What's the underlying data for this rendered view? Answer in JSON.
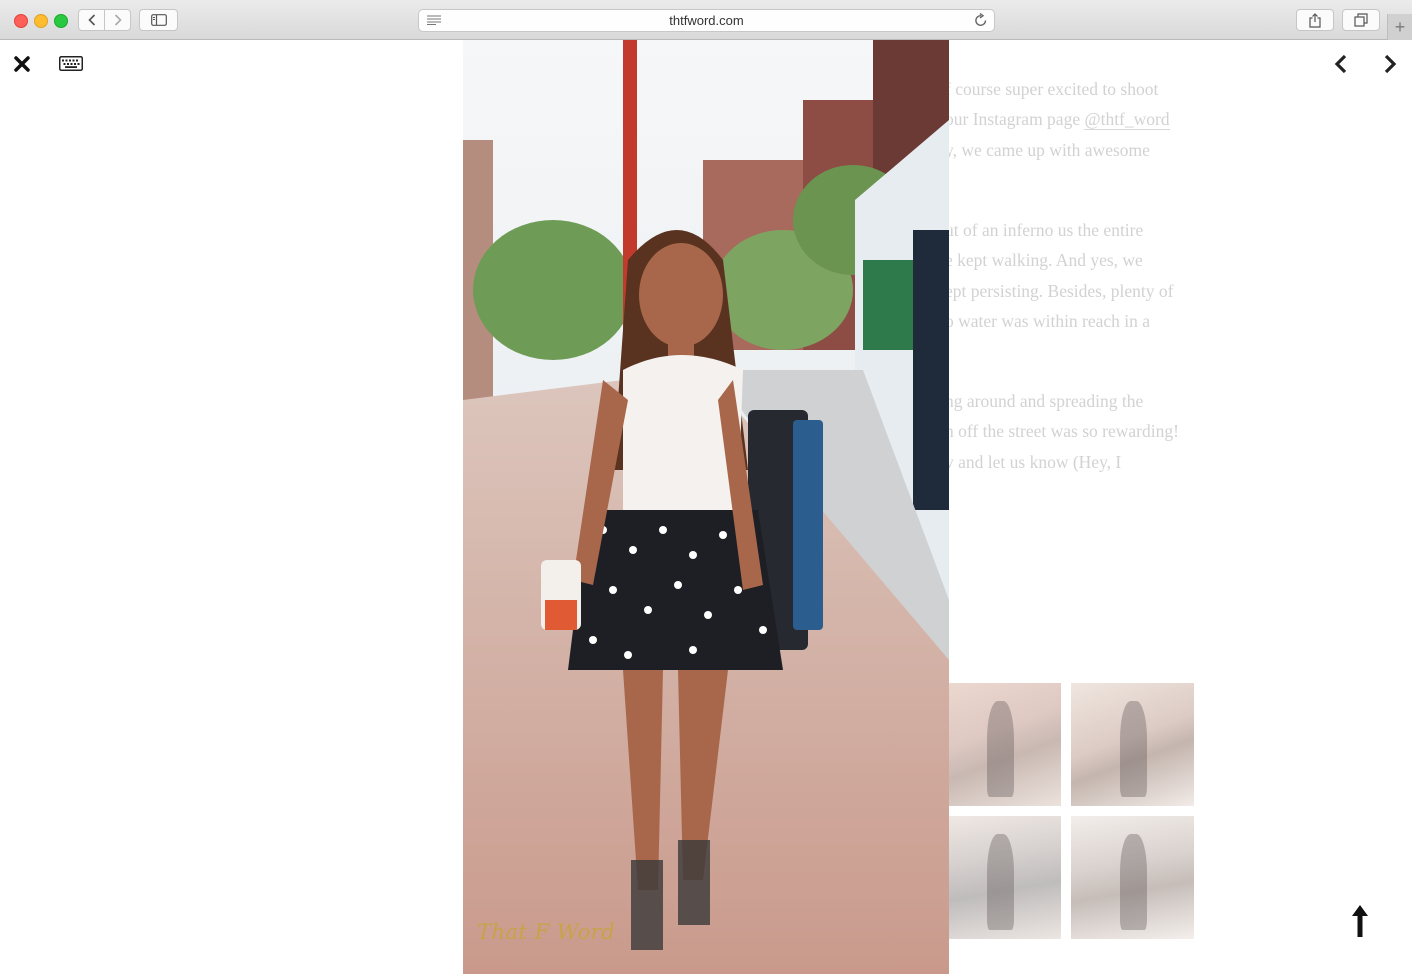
{
  "browser": {
    "url": "thtfword.com"
  },
  "lightbox": {
    "watermark": "That F Word"
  },
  "article": {
    "paragraphs": [
      [
        "f course super excited to shoot",
        "our Instagram page ",
        "y,  we came up with awesome"
      ],
      [
        "ut of an inferno us the entire",
        "e kept walking.  And yes, we",
        "ept persisting.  Besides, plenty of",
        "o water was within reach in a"
      ],
      [
        "ng around and spreading the",
        "n off the street was so rewarding!",
        "v and let us know (Hey, I"
      ]
    ],
    "instagram_handle": "@thtf_word"
  },
  "icons": {
    "close": "close-icon",
    "keyboard": "keyboard-icon",
    "prev": "chevron-left-icon",
    "next": "chevron-right-icon",
    "scroll_top": "arrow-up-icon"
  }
}
